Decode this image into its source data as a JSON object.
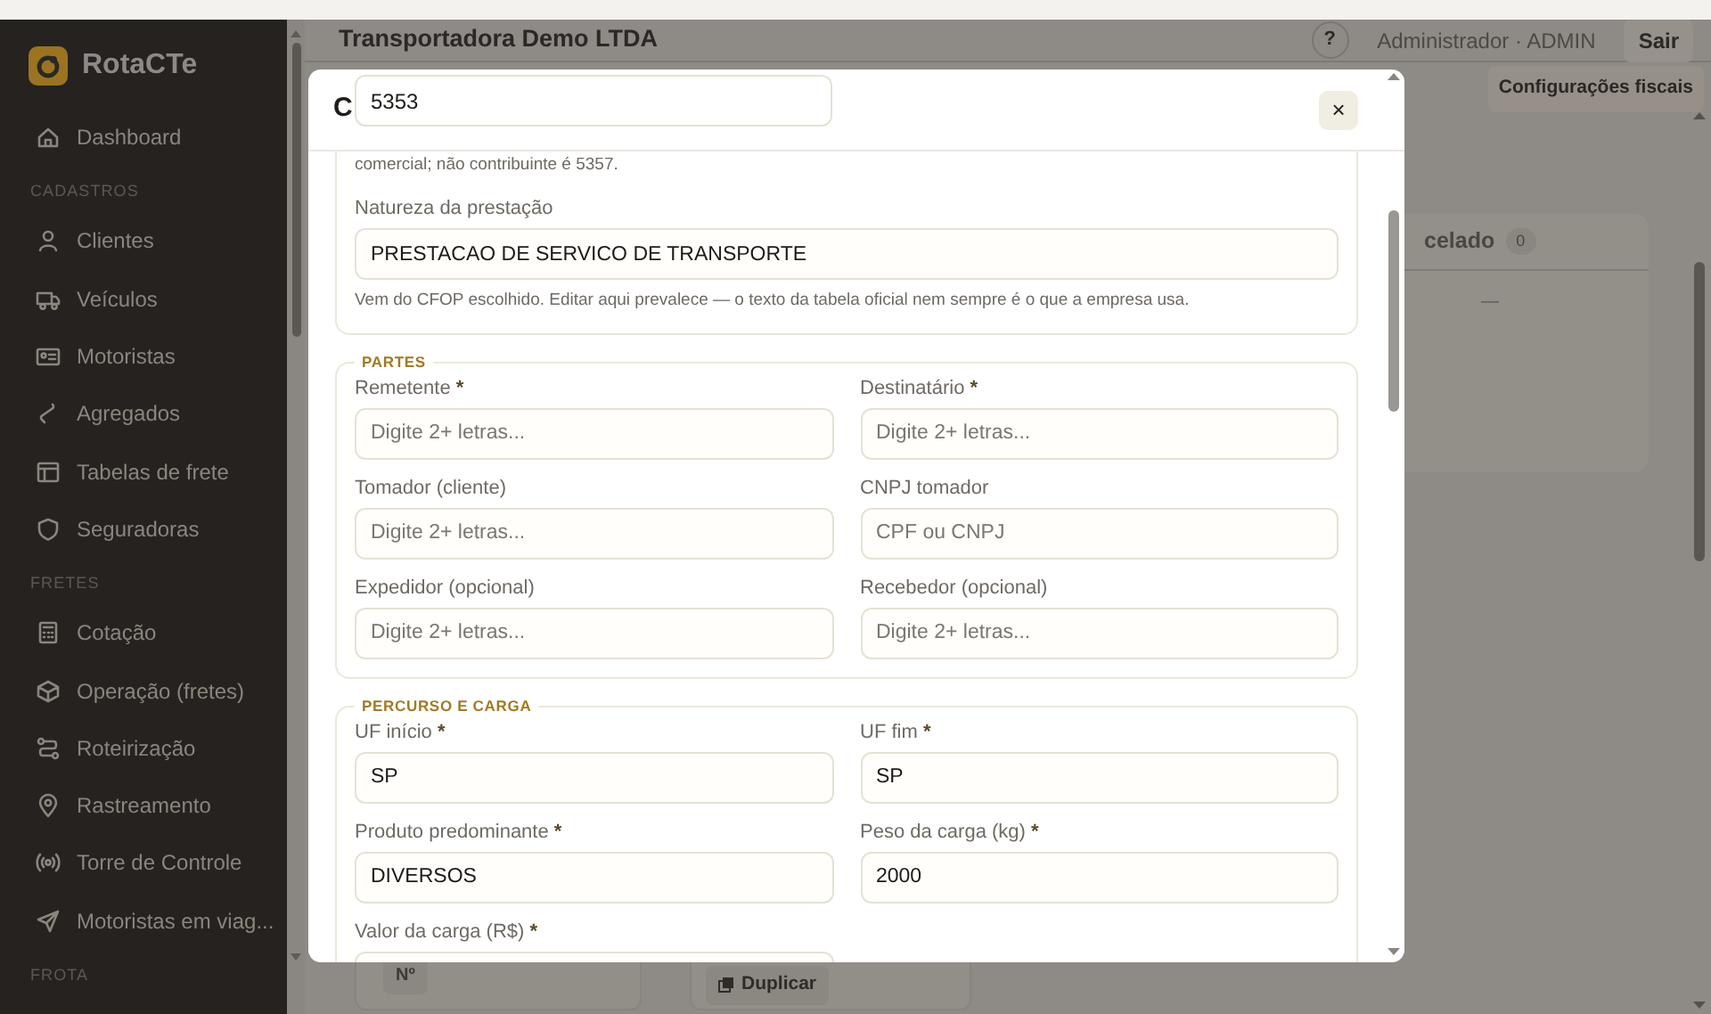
{
  "sidebar": {
    "brand": "RotaCTe",
    "sections": [
      {
        "items": [
          {
            "label": "Dashboard"
          }
        ]
      },
      {
        "heading": "CADASTROS",
        "items": [
          {
            "label": "Clientes"
          },
          {
            "label": "Veículos"
          },
          {
            "label": "Motoristas"
          },
          {
            "label": "Agregados"
          },
          {
            "label": "Tabelas de frete"
          },
          {
            "label": "Seguradoras"
          }
        ]
      },
      {
        "heading": "FRETES",
        "items": [
          {
            "label": "Cotação"
          },
          {
            "label": "Operação (fretes)"
          },
          {
            "label": "Roteirização"
          },
          {
            "label": "Rastreamento"
          },
          {
            "label": "Torre de Controle"
          },
          {
            "label": "Motoristas em viag..."
          }
        ]
      },
      {
        "heading": "FROTA"
      }
    ]
  },
  "topbar": {
    "company": "Transportadora Demo LTDA",
    "help": "?",
    "user": "Administrador · ADMIN",
    "logout": "Sair"
  },
  "toolbar": {
    "button": "Configurações fiscais"
  },
  "board": {
    "column_title": "celado",
    "count": "0",
    "empty": "—",
    "card_badge": "Nº",
    "duplicate_button": "Duplicar"
  },
  "modal": {
    "title": "C",
    "close": "×",
    "floating_field": {
      "value": "5353"
    },
    "sections": [
      {
        "help": "comercial; não contribuinte é 5357.",
        "fields": [
          {
            "label": "Natureza da prestação",
            "value": "PRESTACAO DE SERVICO DE TRANSPORTE",
            "help": "Vem do CFOP escolhido. Editar aqui prevalece — o texto da tabela oficial nem sempre é o que a empresa usa."
          }
        ]
      },
      {
        "legend": "PARTES",
        "fields": [
          {
            "label": "Remetente",
            "required_mark": "*",
            "placeholder": "Digite 2+ letras..."
          },
          {
            "label": "Destinatário",
            "required_mark": "*",
            "placeholder": "Digite 2+ letras..."
          },
          {
            "label": "Tomador (cliente)",
            "placeholder": "Digite 2+ letras..."
          },
          {
            "label": "CNPJ tomador",
            "placeholder": "CPF ou CNPJ"
          },
          {
            "label": "Expedidor (opcional)",
            "placeholder": "Digite 2+ letras..."
          },
          {
            "label": "Recebedor (opcional)",
            "placeholder": "Digite 2+ letras..."
          }
        ]
      },
      {
        "legend": "PERCURSO E CARGA",
        "fields": [
          {
            "label": "UF início",
            "required_mark": "*",
            "value": "SP"
          },
          {
            "label": "UF fim",
            "required_mark": "*",
            "value": "SP"
          },
          {
            "label": "Produto predominante",
            "required_mark": "*",
            "value": "DIVERSOS"
          },
          {
            "label": "Peso da carga (kg)",
            "required_mark": "*",
            "value": "2000"
          },
          {
            "label": "Valor da carga (R$)",
            "required_mark": "*"
          }
        ]
      }
    ]
  }
}
